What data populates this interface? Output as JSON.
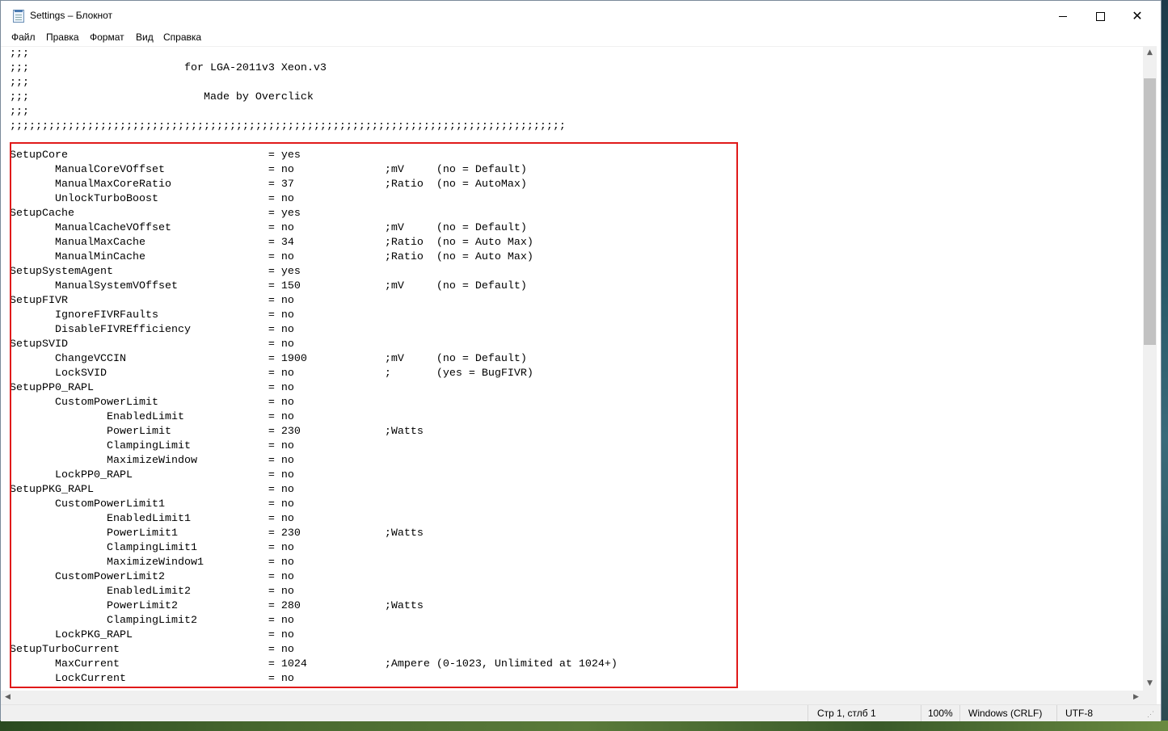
{
  "window": {
    "title": "Settings – Блокнот",
    "controls": {
      "minimize": "minimize",
      "maximize": "maximize",
      "close": "close"
    }
  },
  "menu": {
    "items": [
      "Файл",
      "Правка",
      "Формат",
      "Вид",
      "Справка"
    ]
  },
  "editor": {
    "lines": [
      ";;;",
      ";;;                        for LGA-2011v3 Xeon.v3",
      ";;;",
      ";;;                           Made by Overclick",
      ";;;",
      ";;;;;;;;;;;;;;;;;;;;;;;;;;;;;;;;;;;;;;;;;;;;;;;;;;;;;;;;;;;;;;;;;;;;;;;;;;;;;;;;;;;;;;",
      "",
      "SetupCore                               = yes",
      "       ManualCoreVOffset                = no              ;mV     (no = Default)",
      "       ManualMaxCoreRatio               = 37              ;Ratio  (no = AutoMax)",
      "       UnlockTurboBoost                 = no",
      "SetupCache                              = yes",
      "       ManualCacheVOffset               = no              ;mV     (no = Default)",
      "       ManualMaxCache                   = 34              ;Ratio  (no = Auto Max)",
      "       ManualMinCache                   = no              ;Ratio  (no = Auto Max)",
      "SetupSystemAgent                        = yes",
      "       ManualSystemVOffset              = 150             ;mV     (no = Default)",
      "SetupFIVR                               = no",
      "       IgnoreFIVRFaults                 = no",
      "       DisableFIVREfficiency            = no",
      "SetupSVID                               = no",
      "       ChangeVCCIN                      = 1900            ;mV     (no = Default)",
      "       LockSVID                         = no              ;       (yes = BugFIVR)",
      "SetupPP0_RAPL                           = no",
      "       CustomPowerLimit                 = no",
      "               EnabledLimit             = no",
      "               PowerLimit               = 230             ;Watts",
      "               ClampingLimit            = no",
      "               MaximizeWindow           = no",
      "       LockPP0_RAPL                     = no",
      "SetupPKG_RAPL                           = no",
      "       CustomPowerLimit1                = no",
      "               EnabledLimit1            = no",
      "               PowerLimit1              = 230             ;Watts",
      "               ClampingLimit1           = no",
      "               MaximizeWindow1          = no",
      "       CustomPowerLimit2                = no",
      "               EnabledLimit2            = no",
      "               PowerLimit2              = 280             ;Watts",
      "               ClampingLimit2           = no",
      "       LockPKG_RAPL                     = no",
      "SetupTurboCurrent                       = no",
      "       MaxCurrent                       = 1024            ;Ampere (0-1023, Unlimited at 1024+)",
      "       LockCurrent                      = no"
    ]
  },
  "status": {
    "position": "Стр 1, стлб 1",
    "zoom": "100%",
    "line_ending": "Windows (CRLF)",
    "encoding": "UTF-8"
  },
  "colors": {
    "highlight_border": "#e01a1a",
    "scrollbar_thumb": "#c2c2c2"
  }
}
